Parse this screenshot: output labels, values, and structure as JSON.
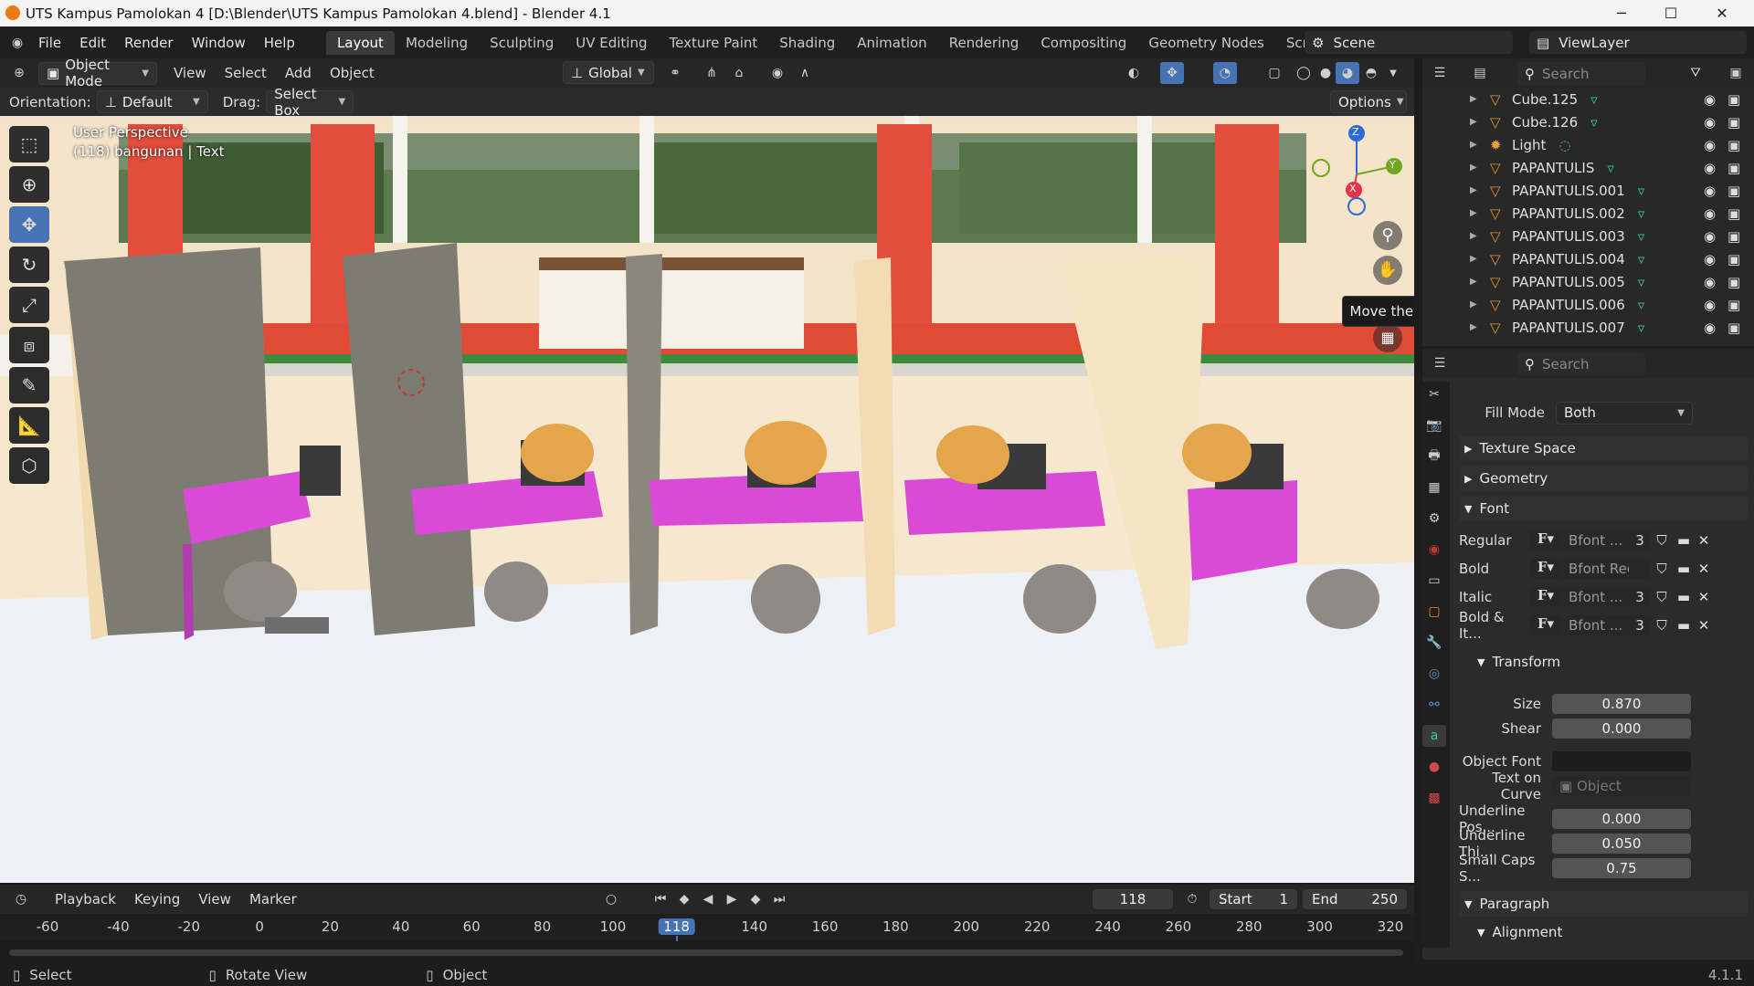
{
  "titlebar": {
    "title": "UTS Kampus Pamolokan 4 [D:\\Blender\\UTS Kampus Pamolokan 4.blend] - Blender 4.1",
    "minimize": "─",
    "maximize": "☐",
    "close": "✕"
  },
  "menu": [
    "File",
    "Edit",
    "Render",
    "Window",
    "Help"
  ],
  "workspaces": [
    "Layout",
    "Modeling",
    "Sculpting",
    "UV Editing",
    "Texture Paint",
    "Shading",
    "Animation",
    "Rendering",
    "Compositing",
    "Geometry Nodes",
    "Scripting"
  ],
  "workspace_add": "+",
  "scene": "Scene",
  "viewlayer": "ViewLayer",
  "viewport": {
    "mode": "Object Mode",
    "menus": [
      "View",
      "Select",
      "Add",
      "Object"
    ],
    "transform_orientation": "Global",
    "orientation_label": "Orientation:",
    "orientation_value": "Default",
    "drag_label": "Drag:",
    "drag_value": "Select Box",
    "options": "Options",
    "overlay_line1": "User Perspective",
    "overlay_line2": "(118) bangunan | Text",
    "tooltip": "Move the view",
    "gizmo": {
      "z": "Z",
      "x": "X",
      "y": "Y"
    }
  },
  "outliner": {
    "search_placeholder": "Search",
    "items": [
      {
        "name": "Cube.125",
        "type": "mesh"
      },
      {
        "name": "Cube.126",
        "type": "mesh"
      },
      {
        "name": "Light",
        "type": "light"
      },
      {
        "name": "PAPANTULIS",
        "type": "mesh"
      },
      {
        "name": "PAPANTULIS.001",
        "type": "mesh"
      },
      {
        "name": "PAPANTULIS.002",
        "type": "mesh"
      },
      {
        "name": "PAPANTULIS.003",
        "type": "mesh"
      },
      {
        "name": "PAPANTULIS.004",
        "type": "mesh"
      },
      {
        "name": "PAPANTULIS.005",
        "type": "mesh"
      },
      {
        "name": "PAPANTULIS.006",
        "type": "mesh"
      },
      {
        "name": "PAPANTULIS.007",
        "type": "mesh"
      }
    ]
  },
  "properties": {
    "search_placeholder": "Search",
    "fill_mode_label": "Fill Mode",
    "fill_mode_value": "Both",
    "texture_space": "Texture Space",
    "geometry": "Geometry",
    "font": "Font",
    "fonts": [
      {
        "label": "Regular",
        "value": "Bfont ...",
        "users": "3"
      },
      {
        "label": "Bold",
        "value": "Bfont Regu...",
        "users": ""
      },
      {
        "label": "Italic",
        "value": "Bfont ...",
        "users": "3"
      },
      {
        "label": "Bold & It...",
        "value": "Bfont ...",
        "users": "3"
      }
    ],
    "transform": "Transform",
    "size_label": "Size",
    "size_value": "0.870",
    "shear_label": "Shear",
    "shear_value": "0.000",
    "object_font_label": "Object Font",
    "text_on_curve_label": "Text on Curve",
    "text_on_curve_placeholder": "Object",
    "underline_pos_label": "Underline Pos...",
    "underline_pos_value": "0.000",
    "underline_thi_label": "Underline Thi...",
    "underline_thi_value": "0.050",
    "small_caps_label": "Small Caps S...",
    "small_caps_value": "0.75",
    "paragraph": "Paragraph",
    "alignment": "Alignment"
  },
  "timeline": {
    "menus": [
      "Playback",
      "Keying",
      "View",
      "Marker"
    ],
    "current_frame": "118",
    "start_label": "Start",
    "start_value": "1",
    "end_label": "End",
    "end_value": "250",
    "ticks": [
      "-60",
      "-40",
      "-20",
      "0",
      "20",
      "40",
      "60",
      "80",
      "100",
      "118",
      "140",
      "160",
      "180",
      "200",
      "220",
      "240",
      "260",
      "280",
      "300",
      "320"
    ]
  },
  "statusbar": {
    "select": "Select",
    "rotate": "Rotate View",
    "object": "Object",
    "version": "4.1.1"
  }
}
